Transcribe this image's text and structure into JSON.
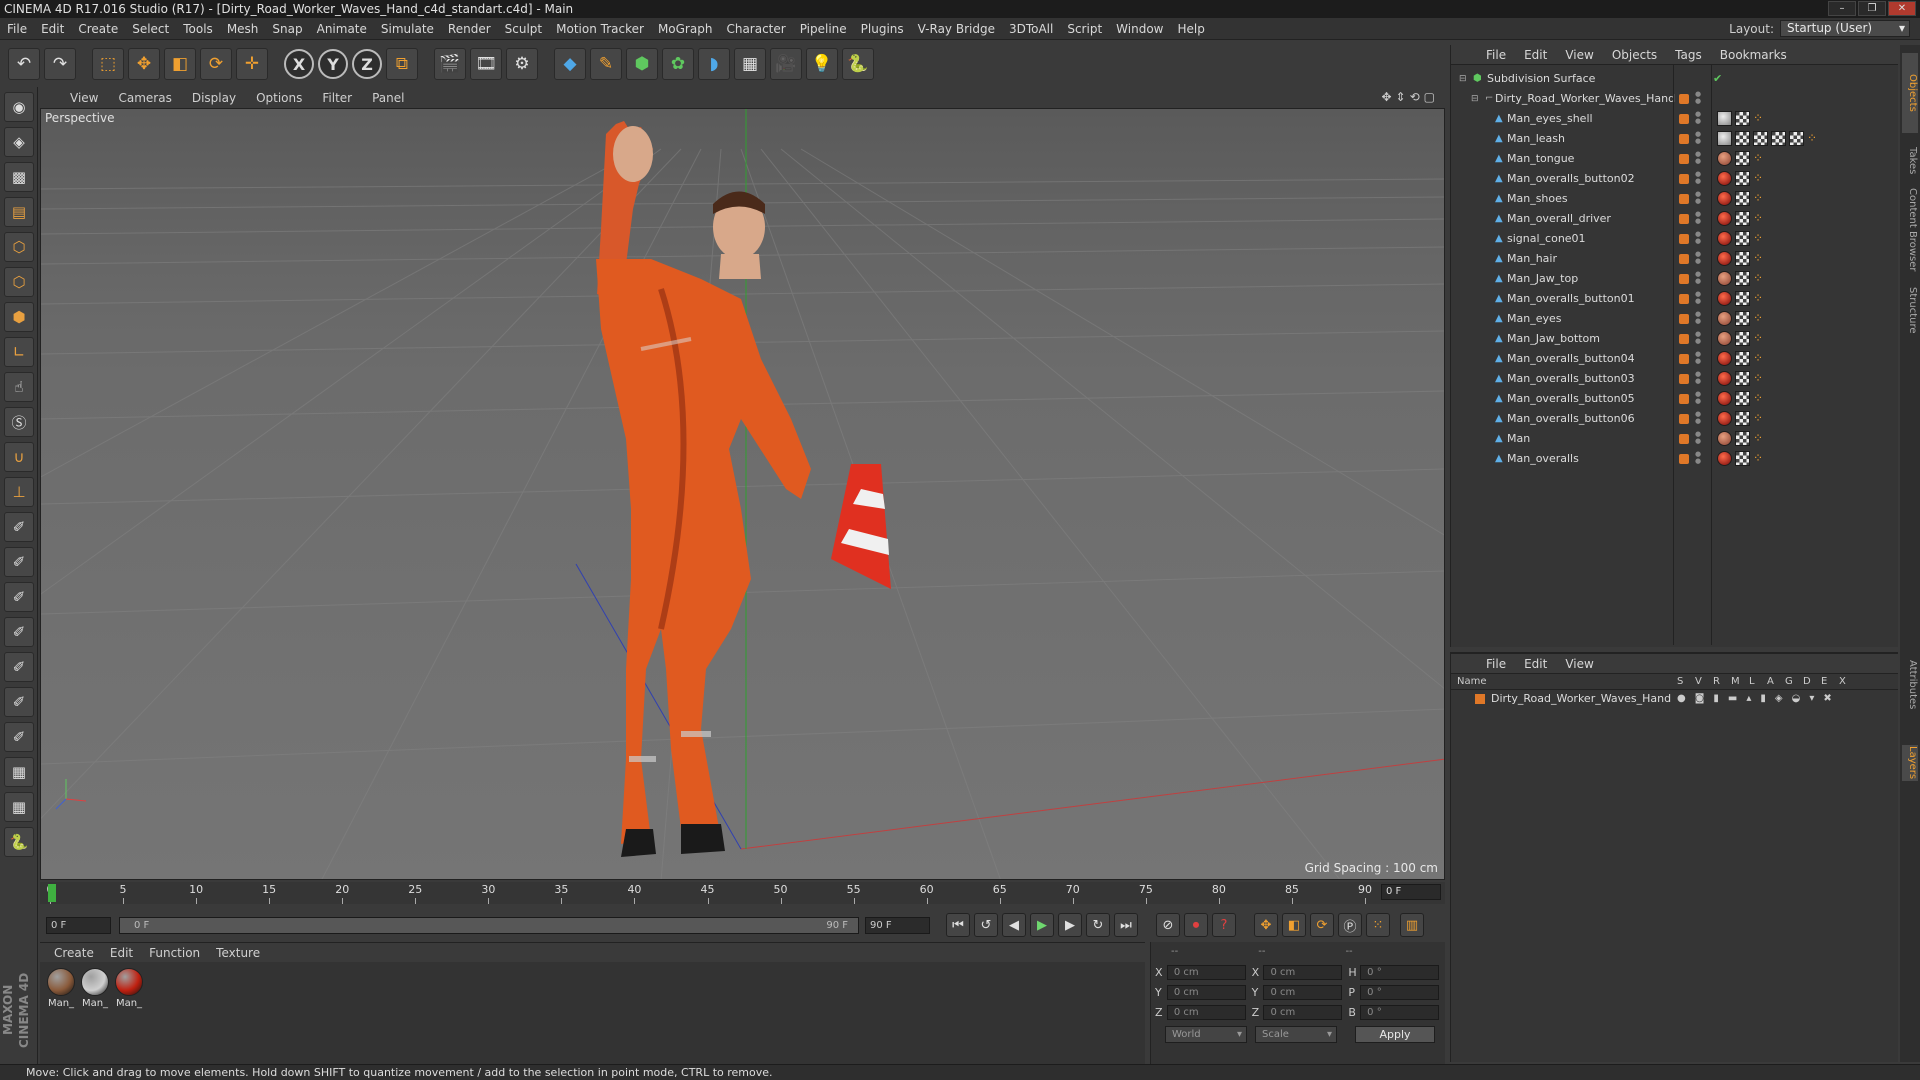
{
  "window": {
    "title": "CINEMA 4D R17.016 Studio (R17) - [Dirty_Road_Worker_Waves_Hand_c4d_standart.c4d] - Main"
  },
  "menubar": {
    "items": [
      "File",
      "Edit",
      "Create",
      "Select",
      "Tools",
      "Mesh",
      "Snap",
      "Animate",
      "Simulate",
      "Render",
      "Sculpt",
      "Motion Tracker",
      "MoGraph",
      "Character",
      "Pipeline",
      "Plugins",
      "V-Ray Bridge",
      "3DToAll",
      "Script",
      "Window",
      "Help"
    ],
    "layout_label": "Layout:",
    "layout_value": "Startup (User)"
  },
  "viewport": {
    "menu": [
      "View",
      "Cameras",
      "Display",
      "Options",
      "Filter",
      "Panel"
    ],
    "label": "Perspective",
    "grid_spacing": "Grid Spacing : 100 cm"
  },
  "timeline": {
    "ticks": [
      0,
      5,
      10,
      15,
      20,
      25,
      30,
      35,
      40,
      45,
      50,
      55,
      60,
      65,
      70,
      75,
      80,
      85,
      90
    ],
    "current_frame": "0 F",
    "start_field": "0 F",
    "slider_start": "0 F",
    "slider_end": "90 F",
    "end_field": "90 F"
  },
  "materials": {
    "menu": [
      "Create",
      "Edit",
      "Function",
      "Texture"
    ],
    "items": [
      {
        "label": "Man_",
        "color": "#8a5a3a"
      },
      {
        "label": "Man_",
        "color": "#cfcfcf"
      },
      {
        "label": "Man_",
        "color": "#c02010"
      }
    ]
  },
  "coords": {
    "headers": [
      "--",
      "--",
      "--"
    ],
    "rows": [
      {
        "a1": "X",
        "v1": "0 cm",
        "a2": "X",
        "v2": "0 cm",
        "a3": "H",
        "v3": "0 °"
      },
      {
        "a1": "Y",
        "v1": "0 cm",
        "a2": "Y",
        "v2": "0 cm",
        "a3": "P",
        "v3": "0 °"
      },
      {
        "a1": "Z",
        "v1": "0 cm",
        "a2": "Z",
        "v2": "0 cm",
        "a3": "B",
        "v3": "0 °"
      }
    ],
    "space": "World",
    "mode": "Scale",
    "apply": "Apply"
  },
  "status": {
    "text": "Move: Click and drag to move elements. Hold down SHIFT to quantize movement / add to the selection in point mode, CTRL to remove."
  },
  "object_manager": {
    "menu": [
      "File",
      "Edit",
      "View",
      "Objects",
      "Tags",
      "Bookmarks"
    ],
    "root": "Subdivision Surface",
    "group": "Dirty_Road_Worker_Waves_Hand",
    "objects": [
      {
        "name": "Man_eyes_shell",
        "tags": [
          "mat3",
          "chk",
          "phong"
        ]
      },
      {
        "name": "Man_leash",
        "tags": [
          "mat3",
          "chk",
          "chk",
          "chk",
          "chk",
          "phong"
        ]
      },
      {
        "name": "Man_tongue",
        "tags": [
          "mat1",
          "chk",
          "phong"
        ]
      },
      {
        "name": "Man_overalls_button02",
        "tags": [
          "mat2",
          "chk",
          "phong"
        ]
      },
      {
        "name": "Man_shoes",
        "tags": [
          "mat2",
          "chk",
          "phong"
        ]
      },
      {
        "name": "Man_overall_driver",
        "tags": [
          "mat2",
          "chk",
          "phong"
        ]
      },
      {
        "name": "signal_cone01",
        "tags": [
          "mat2",
          "chk",
          "phong"
        ]
      },
      {
        "name": "Man_hair",
        "tags": [
          "mat2",
          "chk",
          "phong"
        ]
      },
      {
        "name": "Man_Jaw_top",
        "tags": [
          "mat1",
          "chk",
          "phong"
        ]
      },
      {
        "name": "Man_overalls_button01",
        "tags": [
          "mat2",
          "chk",
          "phong"
        ]
      },
      {
        "name": "Man_eyes",
        "tags": [
          "mat1",
          "chk",
          "phong"
        ]
      },
      {
        "name": "Man_Jaw_bottom",
        "tags": [
          "mat1",
          "chk",
          "phong"
        ]
      },
      {
        "name": "Man_overalls_button04",
        "tags": [
          "mat2",
          "chk",
          "phong"
        ]
      },
      {
        "name": "Man_overalls_button03",
        "tags": [
          "mat2",
          "chk",
          "phong"
        ]
      },
      {
        "name": "Man_overalls_button05",
        "tags": [
          "mat2",
          "chk",
          "phong"
        ]
      },
      {
        "name": "Man_overalls_button06",
        "tags": [
          "mat2",
          "chk",
          "phong"
        ]
      },
      {
        "name": "Man",
        "tags": [
          "mat1",
          "chk",
          "phong"
        ]
      },
      {
        "name": "Man_overalls",
        "tags": [
          "mat2",
          "chk",
          "phong"
        ]
      }
    ]
  },
  "layer_manager": {
    "menu": [
      "File",
      "Edit",
      "View"
    ],
    "columns": [
      "Name",
      "S",
      "V",
      "R",
      "M",
      "L",
      "A",
      "G",
      "D",
      "E",
      "X"
    ],
    "layers": [
      "Dirty_Road_Worker_Waves_Hand"
    ]
  },
  "right_tabs": [
    "Objects",
    "Takes",
    "Content Browser",
    "Structure",
    "Attributes",
    "Layers"
  ]
}
